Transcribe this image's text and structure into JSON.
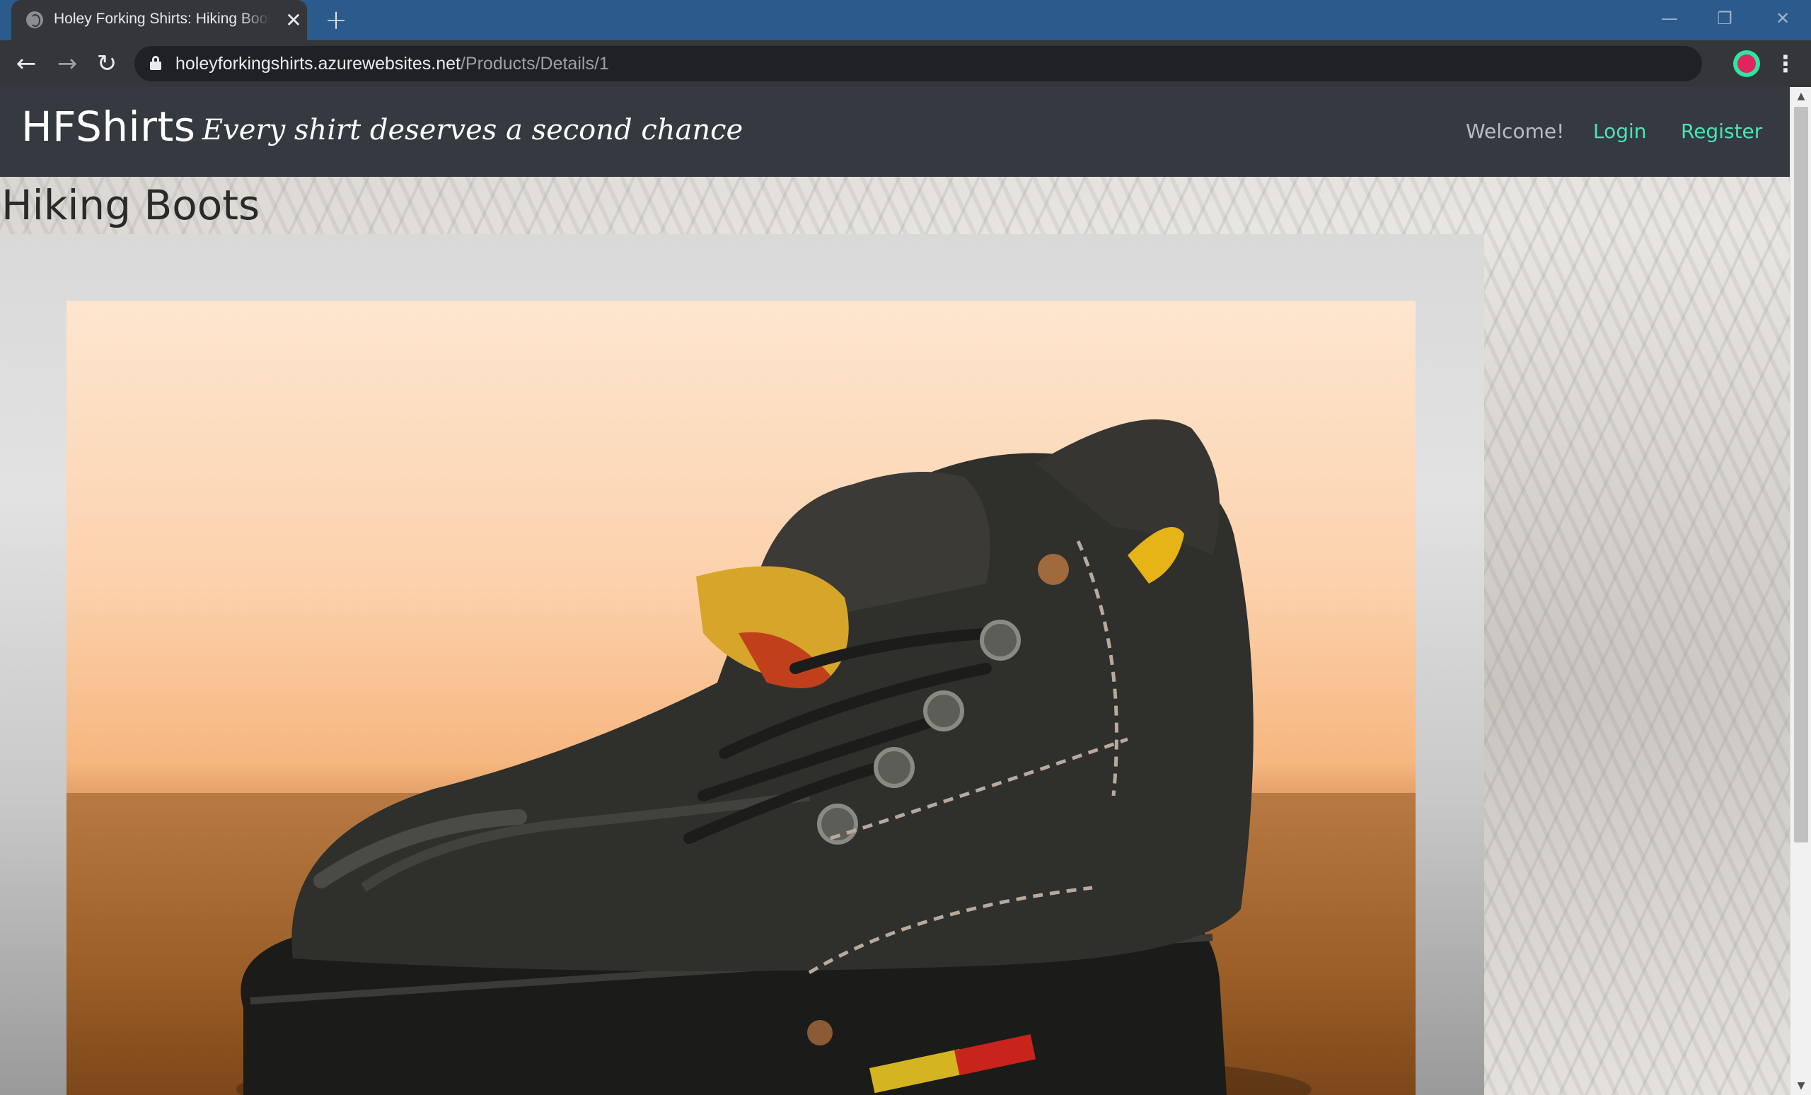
{
  "browser": {
    "tab_title": "Holey Forking Shirts: Hiking Boots",
    "tab_close": "✕",
    "new_tab": "+",
    "url_host": "holeyforkingshirts.azurewebsites.net",
    "url_path": "/Products/Details/1",
    "icons": [
      "globe-icon",
      "back-arrow-icon",
      "forward-arrow-icon",
      "reload-icon",
      "lock-icon",
      "star-icon",
      "extension-icon",
      "kebab-menu-icon"
    ]
  },
  "site": {
    "brand": "HFShirts",
    "tagline": "Every shirt deserves a second chance",
    "nav": {
      "welcome": "Welcome!",
      "login": "Login",
      "register": "Register"
    },
    "colors": {
      "navbar": "#343a40",
      "link": "#4be3b6"
    }
  },
  "product": {
    "title": "Hiking Boots",
    "image_subject": "worn black hiking boot"
  }
}
